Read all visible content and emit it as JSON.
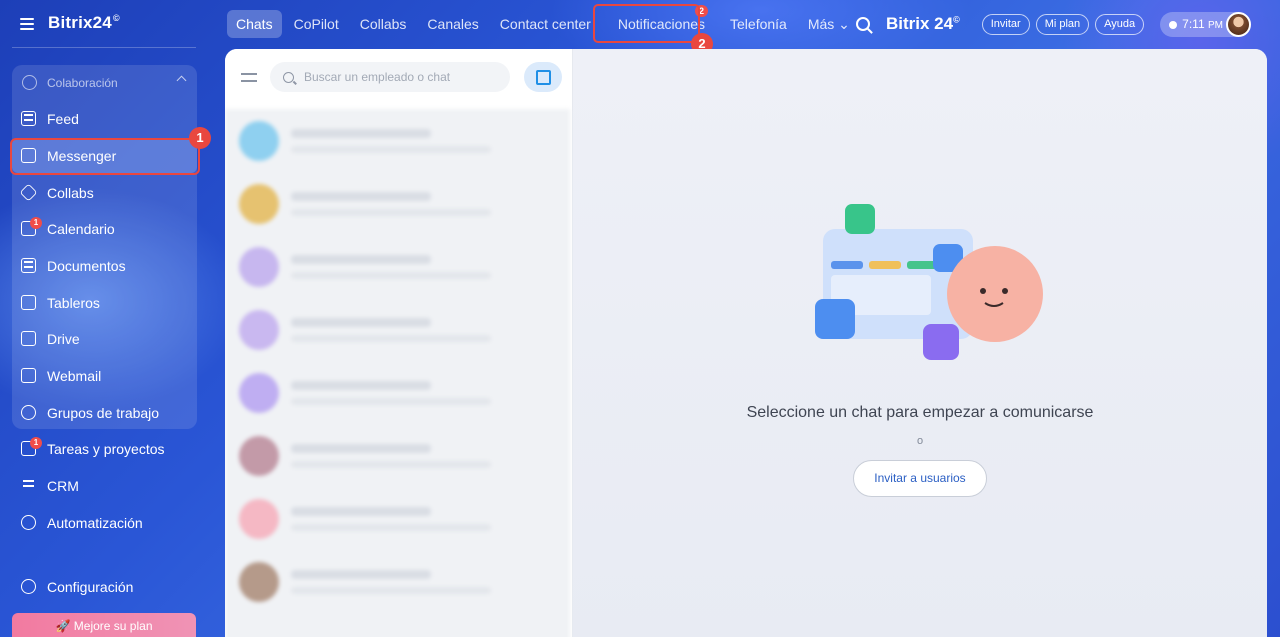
{
  "app": {
    "brand": "Bitrix24",
    "brand_mark": "©"
  },
  "sidebar": {
    "group_label": "Colaboración",
    "items": [
      {
        "label": "Feed",
        "icon": "feed-icon"
      },
      {
        "label": "Messenger",
        "icon": "messenger-icon",
        "active": true
      },
      {
        "label": "Collabs",
        "icon": "collabs-icon"
      },
      {
        "label": "Calendario",
        "icon": "calendar-icon",
        "badge": "1"
      },
      {
        "label": "Documentos",
        "icon": "documents-icon"
      },
      {
        "label": "Tableros",
        "icon": "boards-icon"
      },
      {
        "label": "Drive",
        "icon": "drive-icon"
      },
      {
        "label": "Webmail",
        "icon": "mail-icon"
      },
      {
        "label": "Grupos de trabajo",
        "icon": "workgroups-icon"
      },
      {
        "label": "Tareas y proyectos",
        "icon": "tasks-icon",
        "badge": "1"
      },
      {
        "label": "CRM",
        "icon": "crm-icon"
      },
      {
        "label": "Automatización",
        "icon": "automation-icon"
      }
    ],
    "settings_label": "Configuración",
    "upgrade_label": "Mejore su plan"
  },
  "topnav": {
    "tabs": [
      "Chats",
      "CoPilot",
      "Collabs",
      "Canales",
      "Contact center",
      "Notificaciones",
      "Telefonía",
      "Más"
    ],
    "notifications_count": "2"
  },
  "header": {
    "brand": "Bitrix 24",
    "invite": "Invitar",
    "plan": "Mi plan",
    "help": "Ayuda",
    "time": "7:11",
    "ampm": "PM"
  },
  "chat": {
    "search_placeholder": "Buscar un empleado o chat",
    "empty_title": "Seleccione un chat para empezar a comunicarse",
    "or": "o",
    "invite_button": "Invitar a usuarios"
  },
  "annotations": {
    "step1": "1",
    "step2": "2"
  },
  "colors": {
    "accent": "#2b5fc4",
    "highlight": "#e9473f",
    "badge": "#ef4d4a"
  }
}
